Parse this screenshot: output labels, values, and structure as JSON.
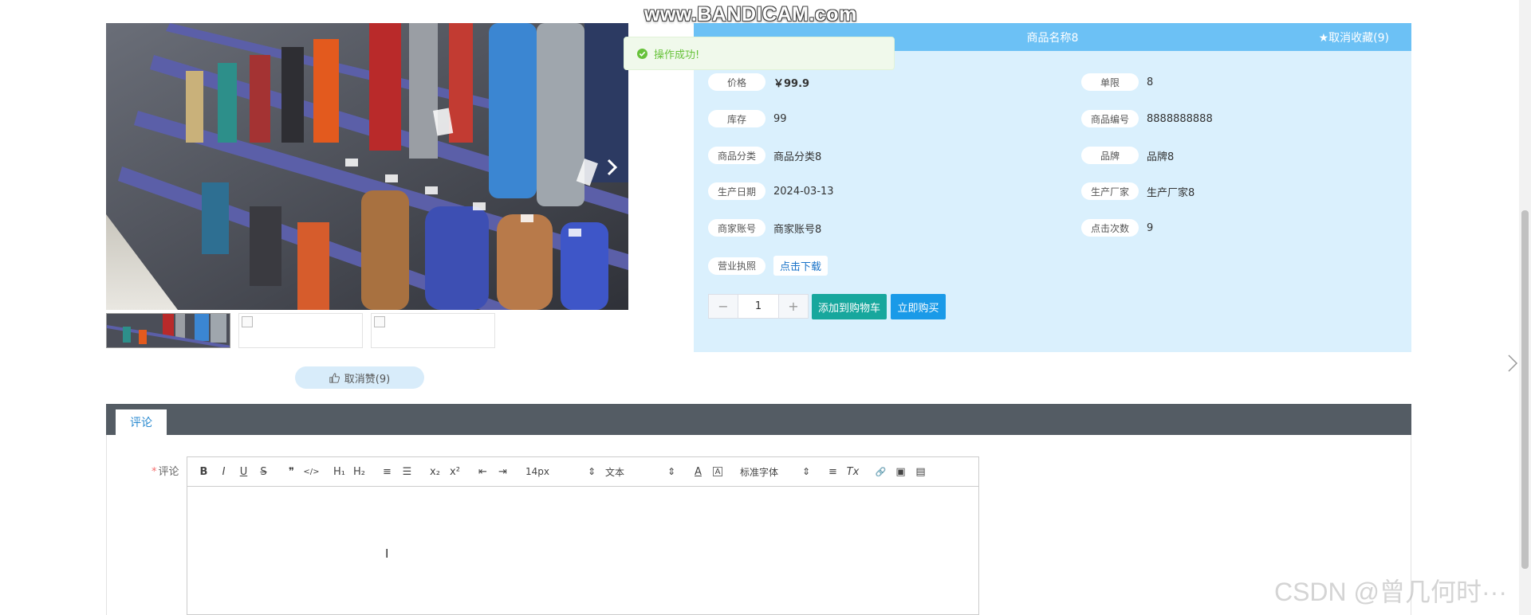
{
  "watermarks": {
    "recorder": "www.BANDICAM.com",
    "author": "CSDN @曾几何时···"
  },
  "toast": {
    "message": "操作成功!"
  },
  "product": {
    "title": "商品名称8",
    "favorite_label": "★取消收藏(9)",
    "fields": {
      "price": {
        "label": "价格",
        "value": "￥99.9"
      },
      "limit": {
        "label": "单限",
        "value": "8"
      },
      "stock": {
        "label": "库存",
        "value": "99"
      },
      "code": {
        "label": "商品编号",
        "value": "8888888888"
      },
      "category": {
        "label": "商品分类",
        "value": "商品分类8"
      },
      "brand": {
        "label": "品牌",
        "value": "品牌8"
      },
      "production_date": {
        "label": "生产日期",
        "value": "2024-03-13"
      },
      "manufacturer": {
        "label": "生产厂家",
        "value": "生产厂家8"
      },
      "merchant_account": {
        "label": "商家账号",
        "value": "商家账号8"
      },
      "click_count": {
        "label": "点击次数",
        "value": "9"
      },
      "business_license": {
        "label": "营业执照",
        "value": "点击下载"
      }
    },
    "quantity": {
      "minus": "−",
      "value": "1",
      "plus": "+"
    },
    "add_to_cart_label": "添加到购物车",
    "buy_now_label": "立即购买",
    "like_label": "取消赞(9)"
  },
  "tabs": [
    {
      "label": "评论"
    }
  ],
  "comment": {
    "label": "评论",
    "required_mark": "*",
    "toolbar": {
      "bold": "B",
      "italic": "I",
      "underline": "U",
      "strike": "S",
      "quote": "❞",
      "code": "</>",
      "h1": "H₁",
      "h2": "H₂",
      "ordered_list": "≡",
      "bullet_list": "☰",
      "subscript": "x₂",
      "superscript": "x²",
      "outdent": "⇤",
      "indent": "⇥",
      "size_select": "14px",
      "text_select": "文本",
      "color": "A",
      "background": "A",
      "font_select": "标准字体",
      "align": "≡",
      "clean": "Tx",
      "link": "🔗",
      "image": "▣",
      "video": "▤"
    }
  },
  "colors": {
    "header": "#6cc1f5",
    "panel": "#daf0fd",
    "cart": "#17a79d",
    "buy": "#1a9ae8",
    "tabs_bar": "#545c64"
  },
  "icons": [
    "chevron-right-icon",
    "thumbs-up-icon",
    "check-circle-icon",
    "broken-image-icon"
  ]
}
